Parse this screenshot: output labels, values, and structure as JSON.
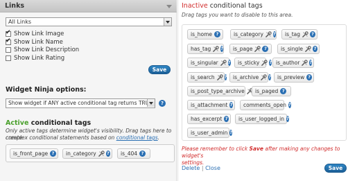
{
  "widget": {
    "title": "Links",
    "category_select": "All Links",
    "options": [
      {
        "label": "Show Link Image",
        "checked": true
      },
      {
        "label": "Show Link Name",
        "checked": true
      },
      {
        "label": "Show Link Description",
        "checked": false
      },
      {
        "label": "Show Link Rating",
        "checked": false
      }
    ],
    "save_label": "Save"
  },
  "widget_ninja": {
    "title": "Widget Ninja options:",
    "mode_select": "Show widget if ANY active conditional tag returns TRUE (log",
    "help": "?"
  },
  "active": {
    "title_prefix": "Active",
    "title_suffix": " conditional tags",
    "desc_line1": "Only active tags determine widget's visibility. Drag tags here to create",
    "desc_line2_prefix": "complex conditional statements based on ",
    "desc_link": "conditional tags",
    "desc_line2_suffix": ".",
    "tags": [
      "is_front_page",
      "in_category",
      "is_404"
    ]
  },
  "inactive": {
    "title_prefix": "Inactive",
    "title_suffix": " conditional tags",
    "subtitle": "Drag tags you want to disable to this area.",
    "tags": [
      "is_home",
      "is_category",
      "is_tag",
      "has_tag",
      "is_page",
      "is_single",
      "is_singular",
      "is_sticky",
      "is_author",
      "is_search",
      "is_archive",
      "is_preview",
      "is_post_type_archive",
      "is_paged",
      "is_attachment",
      "comments_open",
      "has_excerpt",
      "is_user_logged_in",
      "is_user_admin"
    ],
    "warn_prefix": "Please remember to click ",
    "warn_bold": "Save",
    "warn_suffix": " after making any changes to widget's",
    "warn_line2": "settings.",
    "delete_label": "Delete",
    "separator": "|",
    "close_label": "Close",
    "save_label": "Save"
  },
  "icons": {
    "help": "?",
    "tool": "wrench-icon"
  },
  "colors": {
    "active_green": "#4aa02c",
    "inactive_red": "#d12b2b",
    "button_blue": "#1c5f97",
    "link_blue": "#2a6fb3"
  }
}
